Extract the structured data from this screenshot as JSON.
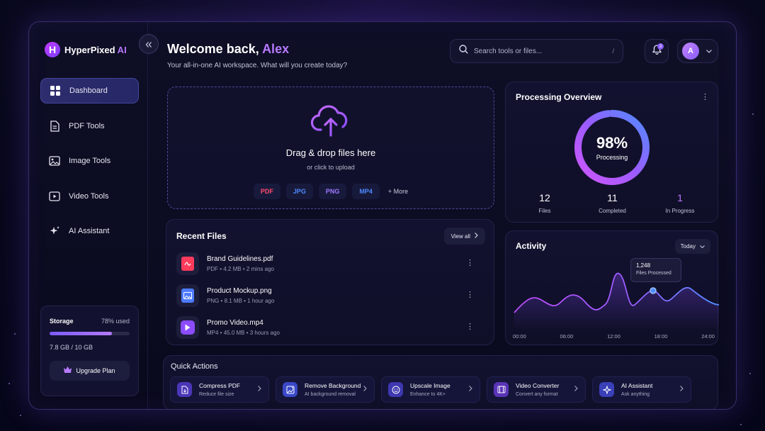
{
  "app": {
    "brand_main": "HyperPixed",
    "brand_ai": " AI",
    "logo_letter": "H"
  },
  "sidebar": {
    "items": [
      {
        "label": "Dashboard",
        "icon": "dashboard-grid-icon",
        "active": true
      },
      {
        "label": "PDF Tools",
        "icon": "document-icon",
        "active": false
      },
      {
        "label": "Image Tools",
        "icon": "image-icon",
        "active": false
      },
      {
        "label": "Video Tools",
        "icon": "video-play-icon",
        "active": false
      },
      {
        "label": "AI Assistant",
        "icon": "sparkles-icon",
        "active": false
      }
    ],
    "storage": {
      "label": "Storage",
      "percent_label": "78% used",
      "percent": 78,
      "used_text": "7.8 GB / 10 GB",
      "upgrade_label": "Upgrade Plan"
    }
  },
  "header": {
    "welcome_prefix": "Welcome back, ",
    "user_name": "Alex",
    "subtitle": "Your all-in-one AI workspace. What will you create today?",
    "search_placeholder": "Search tools or files...",
    "search_shortcut": "/",
    "notification_count": "3",
    "avatar_letter": "A"
  },
  "upload": {
    "title": "Drag & drop files here",
    "subtitle": "or click to upload",
    "types": [
      {
        "label": "PDF",
        "color": "#ff4d6d"
      },
      {
        "label": "JPG",
        "color": "#4d8bff"
      },
      {
        "label": "PNG",
        "color": "#9d7bff"
      },
      {
        "label": "MP4",
        "color": "#4d8bff"
      }
    ],
    "more_label": "+ More"
  },
  "recent_files": {
    "title": "Recent Files",
    "view_all_label": "View all",
    "files": [
      {
        "name": "Brand Guidelines.pdf",
        "meta": "PDF • 4.2 MB • 2 mins ago",
        "icon": "pdf-file-icon",
        "color": "#ff3b5c"
      },
      {
        "name": "Product Mockup.png",
        "meta": "PNG • 8.1 MB • 1 hour ago",
        "icon": "image-file-icon",
        "color": "#4d7bff"
      },
      {
        "name": "Promo Video.mp4",
        "meta": "MP4 • 45.0 MB • 3 hours ago",
        "icon": "video-file-icon",
        "color": "#8b4dff"
      }
    ]
  },
  "overview": {
    "title": "Processing Overview",
    "percent": 98,
    "percent_label": "98%",
    "center_label": "Processing",
    "stats": [
      {
        "value": "12",
        "label": "Files"
      },
      {
        "value": "11",
        "label": "Completed"
      },
      {
        "value": "1",
        "label": "In Progress"
      }
    ]
  },
  "activity": {
    "title": "Activity",
    "range_label": "Today",
    "tooltip_value": "1,248",
    "tooltip_label": "Files Processed",
    "x_labels": [
      "00:00",
      "06:00",
      "12:00",
      "18:00",
      "24:00"
    ]
  },
  "quick_actions": {
    "title": "Quick Actions",
    "items": [
      {
        "title": "Compress PDF",
        "subtitle": "Reduce file size",
        "icon": "compress-icon",
        "color": "#6d4dff"
      },
      {
        "title": "Remove Background",
        "subtitle": "AI background removal",
        "icon": "background-remove-icon",
        "color": "#4d6dff"
      },
      {
        "title": "Upscale Image",
        "subtitle": "Enhance to 4K+",
        "icon": "upscale-icon",
        "color": "#5d4dff"
      },
      {
        "title": "Video Converter",
        "subtitle": "Convert any format",
        "icon": "film-icon",
        "color": "#7d4dff"
      },
      {
        "title": "AI Assistant",
        "subtitle": "Ask anything",
        "icon": "sparkle-icon",
        "color": "#4d5dff"
      }
    ]
  },
  "colors": {
    "accent": "#b779ff",
    "primary": "#7b5cff"
  }
}
